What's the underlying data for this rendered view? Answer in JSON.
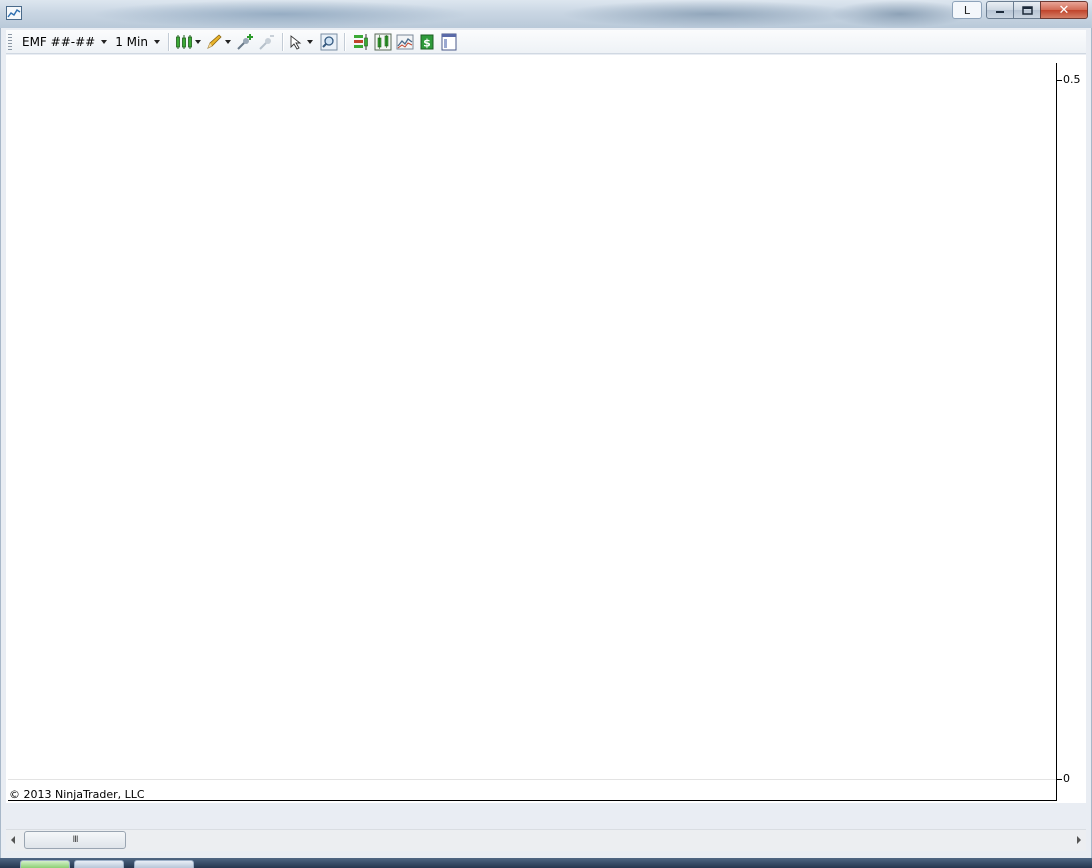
{
  "window": {
    "user_button_label": "L",
    "close_glyph": "✕"
  },
  "toolbar": {
    "instrument": "EMF ##-##",
    "interval": "1 Min",
    "icons": [
      "candlestick-chart-icon",
      "drawing-pencil-icon",
      "add-indicator-icon",
      "remove-indicator-icon",
      "cursor-pointer-icon",
      "zoom-magnifier-icon",
      "chart-data-series-icon",
      "bar-type-icon",
      "line-chart-icon",
      "dollar-order-icon",
      "chart-properties-icon"
    ]
  },
  "chart": {
    "y_axis": {
      "ticks": [
        {
          "value": 0.5,
          "label": "0.5"
        },
        {
          "value": 0,
          "label": "0"
        }
      ],
      "ylim": [
        0,
        0.5
      ]
    },
    "copyright": "© 2013 NinjaTrader, LLC"
  },
  "scrollbar": {
    "thumb_grip": "III"
  },
  "colors": {
    "chart_background": "#ffffff",
    "axis": "#000000",
    "candle_green": "#3aa935",
    "pencil_yellow": "#e8b32a",
    "close_red": "#c0432b"
  }
}
